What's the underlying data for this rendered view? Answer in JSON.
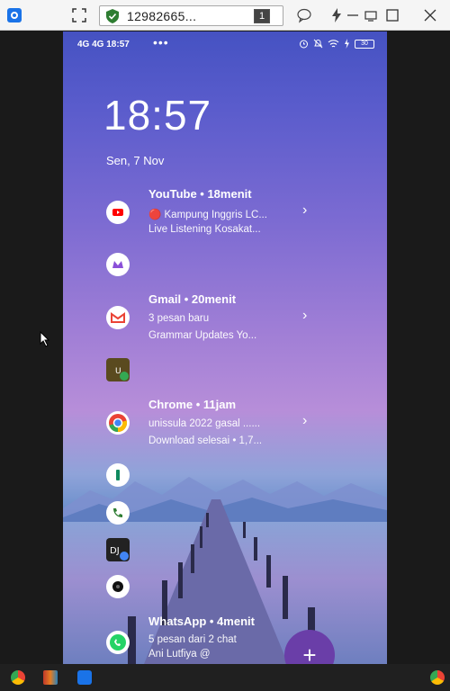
{
  "window": {
    "address_text": "12982665...",
    "tab_count": "1"
  },
  "status_bar": {
    "left_text": "4G 4G 18:57",
    "right_battery": "30"
  },
  "lockscreen": {
    "time": "18:57",
    "date": "Sen, 7 Nov"
  },
  "notifications": [
    {
      "app": "YouTube",
      "title": "YouTube • 18menit",
      "line1": "🔴 Kampung Inggris LC...",
      "line2": "Live Listening Kosakat..."
    },
    {
      "app": "Gmail",
      "title": "Gmail • 20menit",
      "line1": "3 pesan baru",
      "line2": "Grammar Updates    Yo..."
    },
    {
      "app": "Chrome",
      "title": "Chrome • 11jam",
      "line1": "unissula 2022 gasal ......",
      "line2": "Download selesai • 1,7..."
    },
    {
      "app": "WhatsApp",
      "title": "WhatsApp • 4menit",
      "line1": "5 pesan dari 2 chat",
      "line2": "Ani Lutfiya @"
    }
  ],
  "icons": {
    "colors": {
      "youtube": "#ff0000",
      "gmail_red": "#ea4335",
      "chrome_green": "#34a853",
      "whatsapp": "#25d366",
      "fab": "#6a3ea8"
    }
  },
  "fab_label": "+"
}
